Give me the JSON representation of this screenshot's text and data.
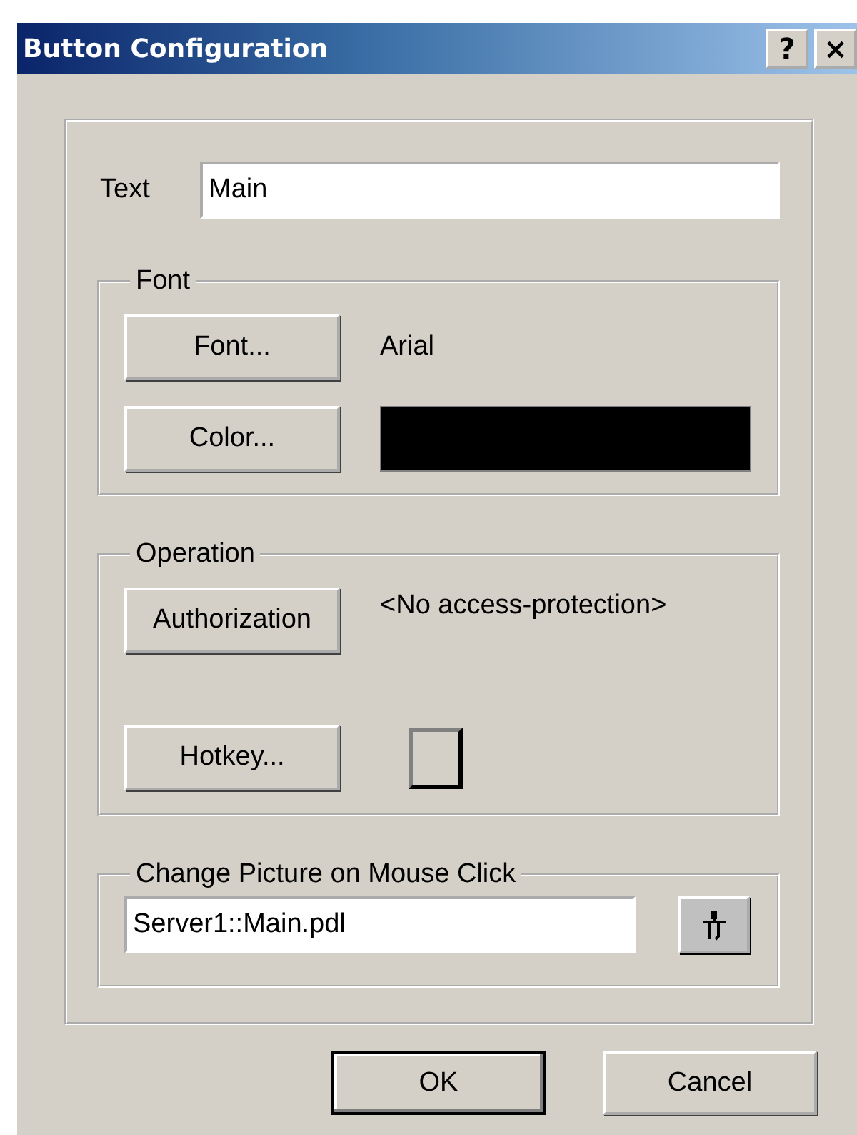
{
  "window": {
    "title": "Button Configuration",
    "title_buttons": [
      "?",
      "×"
    ]
  },
  "text_field": {
    "label": "Text",
    "value": "Main"
  },
  "font_group": {
    "title": "Font",
    "font_button": "Font...",
    "font_name": "Arial",
    "color_button": "Color...",
    "color": "#000000"
  },
  "operation_group": {
    "title": "Operation",
    "authorization_button": "Authorization",
    "authorization_value": "<No access-protection>",
    "hotkey_button": "Hotkey..."
  },
  "picture_group": {
    "title": "Change Picture on Mouse Click",
    "value": "Server1::Main.pdl"
  },
  "buttons": [
    {
      "label": "OK",
      "default": true
    },
    {
      "label": "Cancel",
      "default": false
    }
  ]
}
